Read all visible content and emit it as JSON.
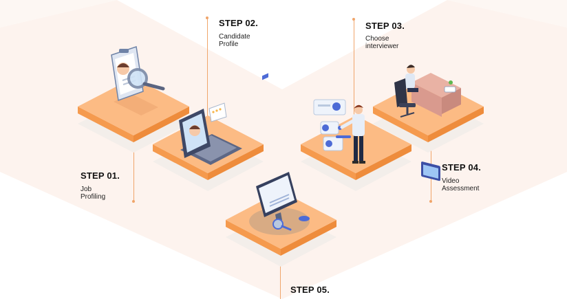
{
  "steps": [
    {
      "title": "STEP 01.",
      "line1": "Job",
      "line2": "Profiling",
      "icon": "magnifier-clipboard-icon"
    },
    {
      "title": "STEP 02.",
      "line1": "Candidate",
      "line2": "Profile",
      "icon": "laptop-profile-icon"
    },
    {
      "title": "STEP 03.",
      "line1": "Choose",
      "line2": "interviewer",
      "icon": "person-choosing-profiles-icon"
    },
    {
      "title": "STEP 04.",
      "line1": "Video",
      "line2": "Assessment",
      "icon": "desk-video-call-icon"
    },
    {
      "title": "STEP 05.",
      "icon": "dashboard-monitor-icon"
    }
  ],
  "colors": {
    "accent": "#f7a15a",
    "tile_top": "#fcbb84",
    "tile_side": "#f59a4e",
    "line": "#f0a56a",
    "background_band": "#fdf3ee"
  }
}
